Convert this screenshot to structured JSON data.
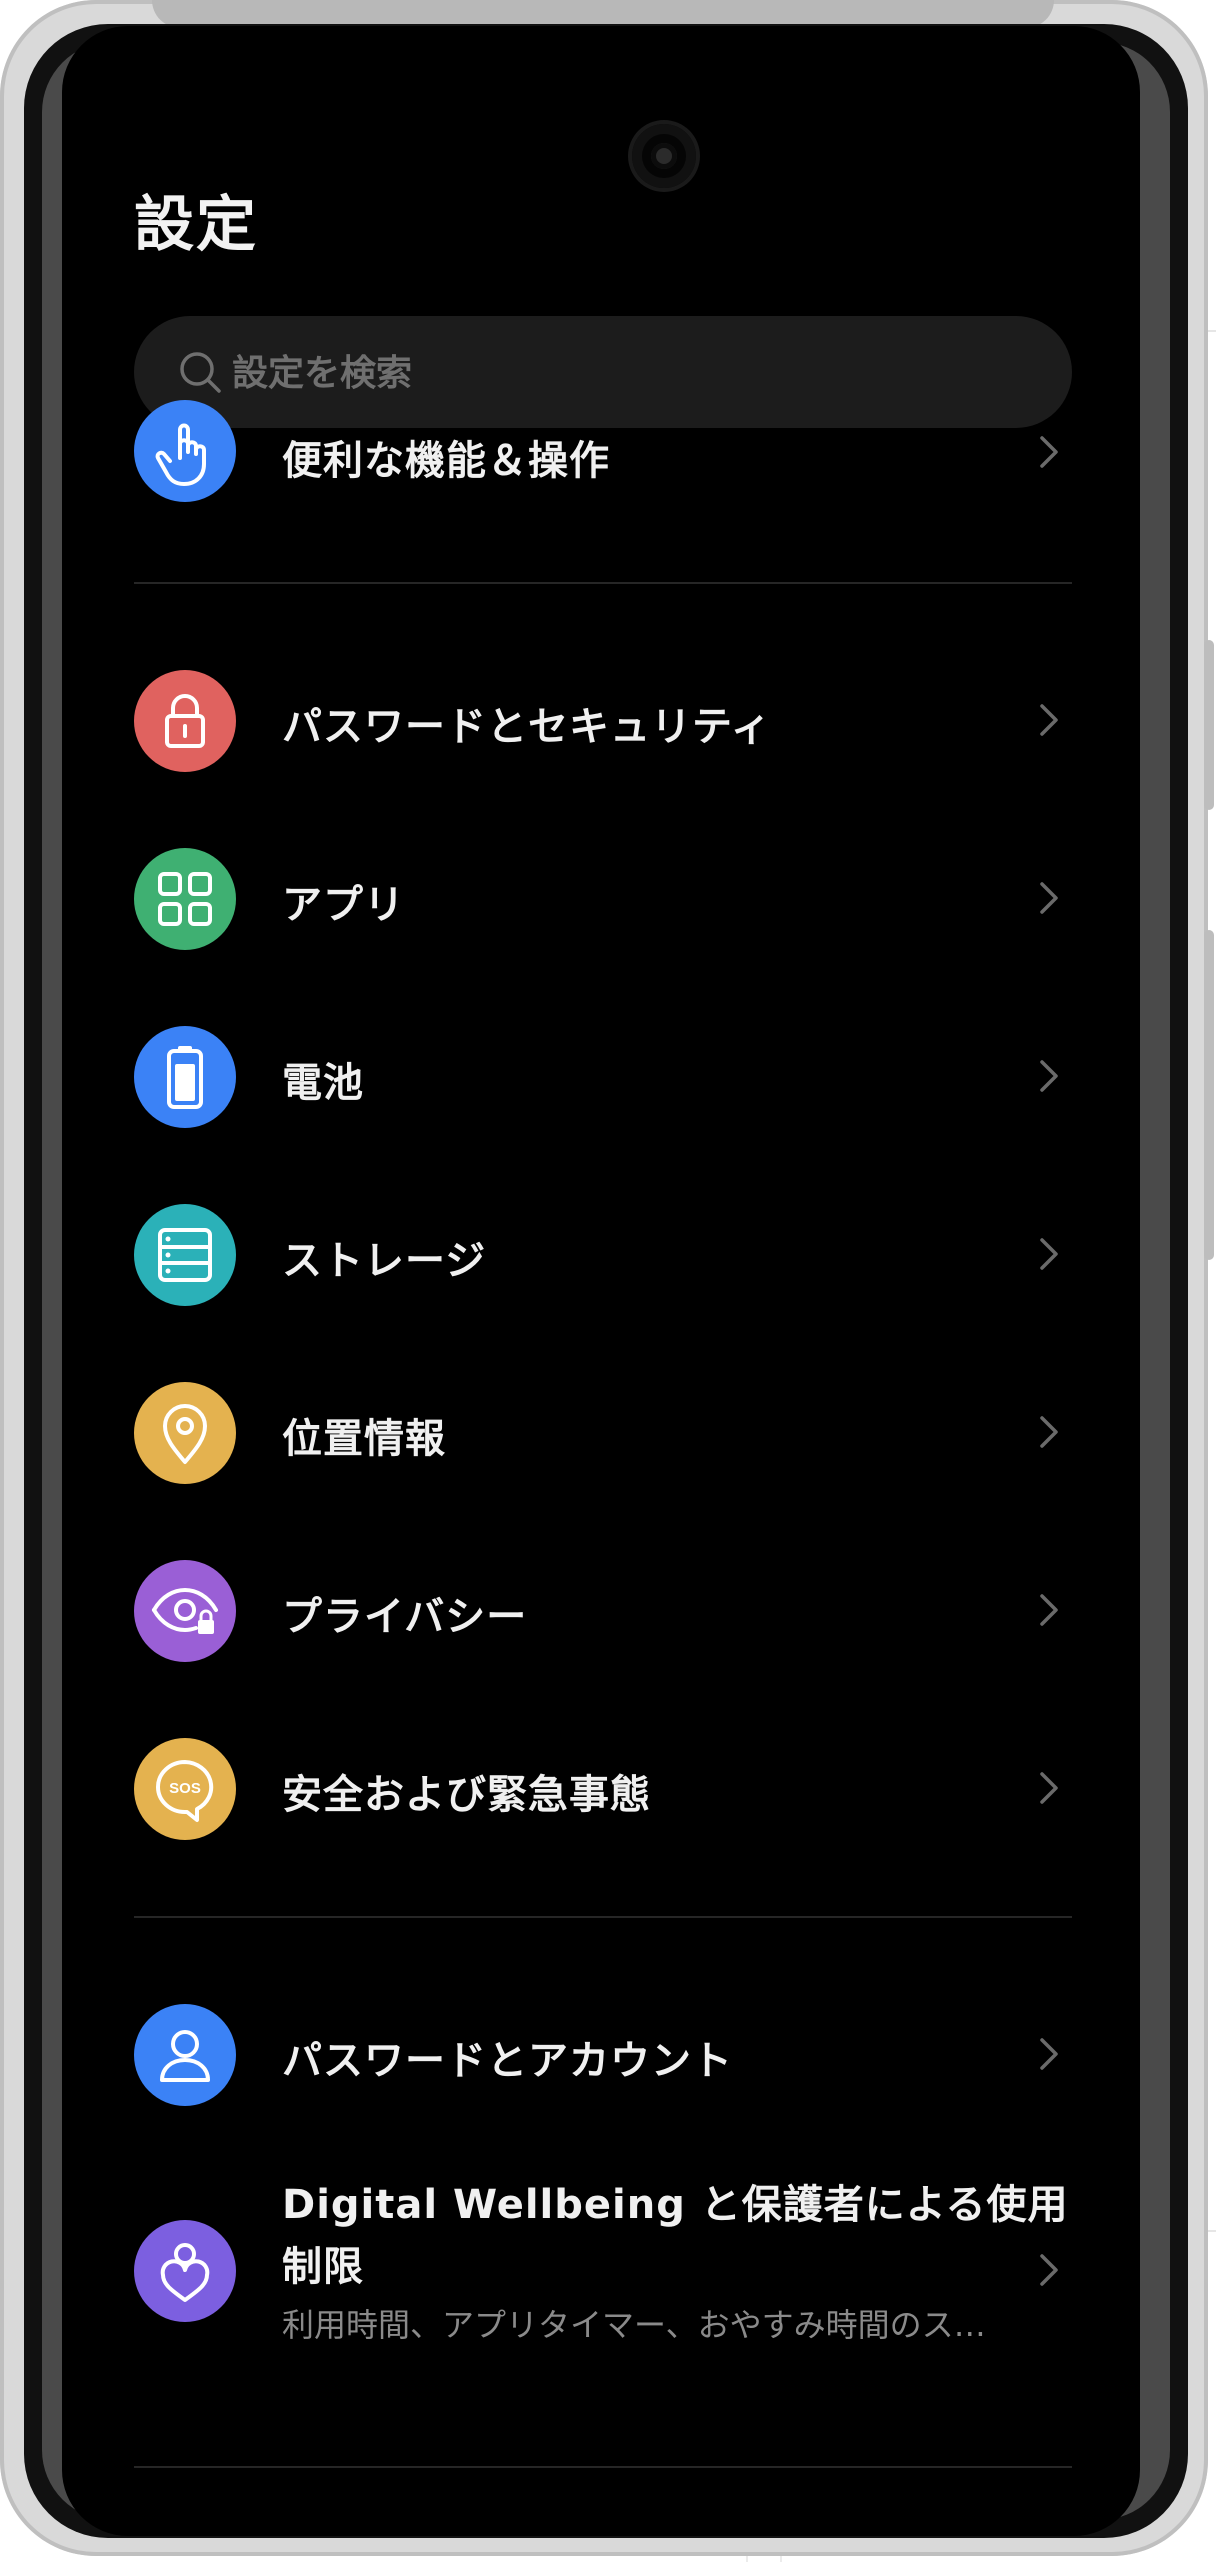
{
  "page": {
    "title": "設定"
  },
  "search": {
    "placeholder": "設定を検索",
    "value": ""
  },
  "items": [
    {
      "label": "便利な機能＆操作",
      "icon": "pointer-hand-icon",
      "color": "#3b82f6"
    },
    {
      "label": "パスワードとセキュリティ",
      "icon": "lock-icon",
      "color": "#e0625f"
    },
    {
      "label": "アプリ",
      "icon": "apps-grid-icon",
      "color": "#3fb072"
    },
    {
      "label": "電池",
      "icon": "battery-icon",
      "color": "#3b82f6"
    },
    {
      "label": "ストレージ",
      "icon": "storage-icon",
      "color": "#2bb1b8"
    },
    {
      "label": "位置情報",
      "icon": "location-pin-icon",
      "color": "#e4b24f"
    },
    {
      "label": "プライバシー",
      "icon": "privacy-eye-icon",
      "color": "#9a5fd6"
    },
    {
      "label": "安全および緊急事態",
      "icon": "sos-icon",
      "color": "#e4b24f"
    },
    {
      "label": "パスワードとアカウント",
      "icon": "account-icon",
      "color": "#3b82f6"
    },
    {
      "label_line1": "Digital Wellbeing と保護者による使用",
      "label_line2": "制限",
      "subtitle": "利用時間、アプリタイマー、おやすみ時間のスケ…",
      "icon": "heart-person-icon",
      "color": "#7c5fe0"
    }
  ]
}
